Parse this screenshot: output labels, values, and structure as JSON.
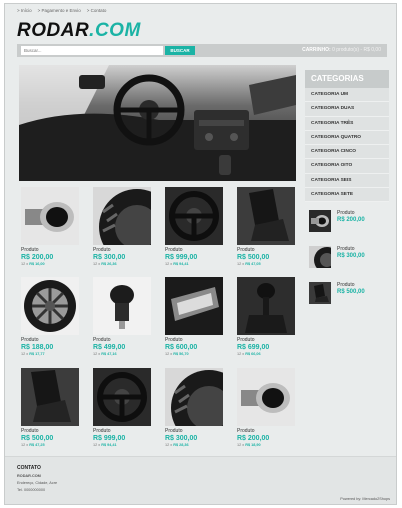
{
  "topnav": {
    "items": [
      "> Início",
      "> Pagamento e Envio",
      "> Contato"
    ]
  },
  "logo": {
    "part1": "RODAR",
    "part2": ".COM"
  },
  "search": {
    "placeholder": "Buscar...",
    "button": "BUSCAR"
  },
  "cart": {
    "label": "CARRINHO:",
    "info": "0 produto(s) - R$ 0,00"
  },
  "sidebar": {
    "title": "CATEGORIAS",
    "categories": [
      "CATEGORIA UM",
      "CATEGORIA DUAS",
      "CATEGORIA TRÊS",
      "CATEGORIA QUATRO",
      "CATEGORIA CINCO",
      "CATEGORIA OITO",
      "CATEGORIA SEIS",
      "CATEGORIA SETE"
    ],
    "featured": [
      {
        "name": "Produto",
        "price": "R$ 200,00",
        "icon": "exhaust-pipe"
      },
      {
        "name": "Produto",
        "price": "R$ 300,00",
        "icon": "tire"
      },
      {
        "name": "Produto",
        "price": "R$ 500,00",
        "icon": "car-seat"
      }
    ]
  },
  "products": [
    {
      "name": "Produto",
      "price": "R$ 200,00",
      "inst_prefix": "12 x",
      "inst_value": "R$ 16,00",
      "icon": "exhaust-pipe"
    },
    {
      "name": "Produto",
      "price": "R$ 300,00",
      "inst_prefix": "12 x",
      "inst_value": "R$ 26,36",
      "icon": "tire"
    },
    {
      "name": "Produto",
      "price": "R$ 999,00",
      "inst_prefix": "12 x",
      "inst_value": "R$ 94,41",
      "icon": "steering-wheel"
    },
    {
      "name": "Produto",
      "price": "R$ 500,00",
      "inst_prefix": "12 x",
      "inst_value": "R$ 47,05",
      "icon": "car-seat"
    },
    {
      "name": "Produto",
      "price": "R$ 188,00",
      "inst_prefix": "12 x",
      "inst_value": "R$ 17,77",
      "icon": "alloy-wheel"
    },
    {
      "name": "Produto",
      "price": "R$ 499,00",
      "inst_prefix": "12 x",
      "inst_value": "R$ 47,16",
      "icon": "gear-knob"
    },
    {
      "name": "Produto",
      "price": "R$ 600,00",
      "inst_prefix": "12 x",
      "inst_value": "R$ 56,70",
      "icon": "headlight"
    },
    {
      "name": "Produto",
      "price": "R$ 699,00",
      "inst_prefix": "12 x",
      "inst_value": "R$ 66,06",
      "icon": "gear-shift"
    },
    {
      "name": "Produto",
      "price": "R$ 500,00",
      "inst_prefix": "12 x",
      "inst_value": "R$ 47,25",
      "icon": "car-seat"
    },
    {
      "name": "Produto",
      "price": "R$ 999,00",
      "inst_prefix": "12 x",
      "inst_value": "R$ 94,41",
      "icon": "steering-wheel"
    },
    {
      "name": "Produto",
      "price": "R$ 300,00",
      "inst_prefix": "12 x",
      "inst_value": "R$ 28,36",
      "icon": "tire"
    },
    {
      "name": "Produto",
      "price": "R$ 200,00",
      "inst_prefix": "12 x",
      "inst_value": "R$ 18,90",
      "icon": "exhaust-pipe"
    }
  ],
  "footer": {
    "title": "CONTATO",
    "company": "RODAR.COM",
    "address": "Endereço, Cidade, Acre",
    "phone": "Tel. 0000000000",
    "powered": "Powered by: Mercado2Shops"
  },
  "colors": {
    "accent": "#1bb3a5",
    "bg": "#e9ecec"
  }
}
